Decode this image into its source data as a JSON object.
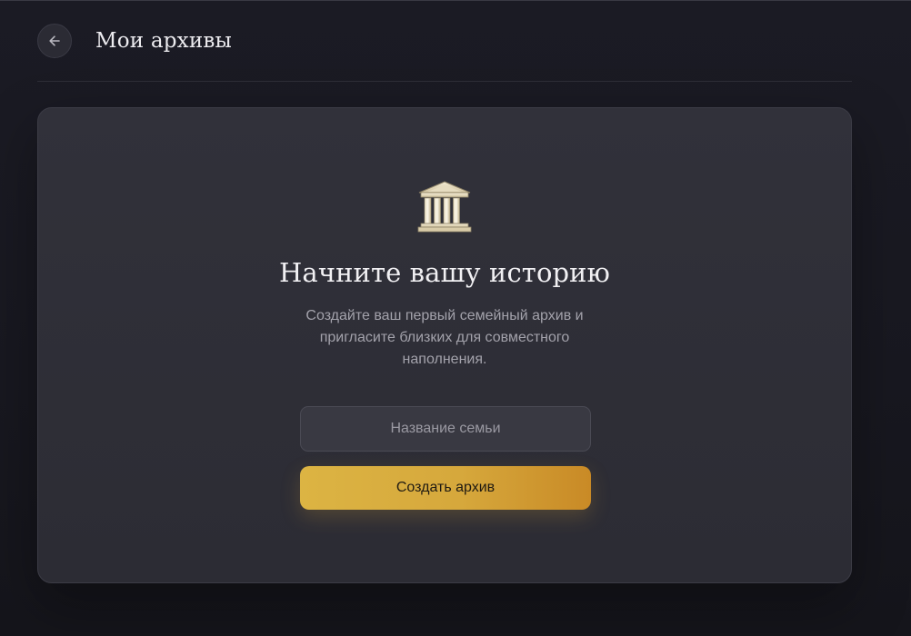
{
  "header": {
    "back_icon": "arrow-left-icon",
    "title": "Мои архивы"
  },
  "empty_state": {
    "icon": "classical-building-icon",
    "title": "Начните вашу историю",
    "description": "Создайте ваш первый семейный архив и пригласите близких для совместного наполнения.",
    "input": {
      "placeholder": "Название семьи",
      "value": ""
    },
    "create_button_label": "Создать архив"
  },
  "colors": {
    "background": "#1b1b24",
    "card": "#2f2f37",
    "accent_start": "#dcb443",
    "accent_end": "#c98a26",
    "text_primary": "#f1f0f3",
    "text_secondary": "#a3a2ab"
  }
}
